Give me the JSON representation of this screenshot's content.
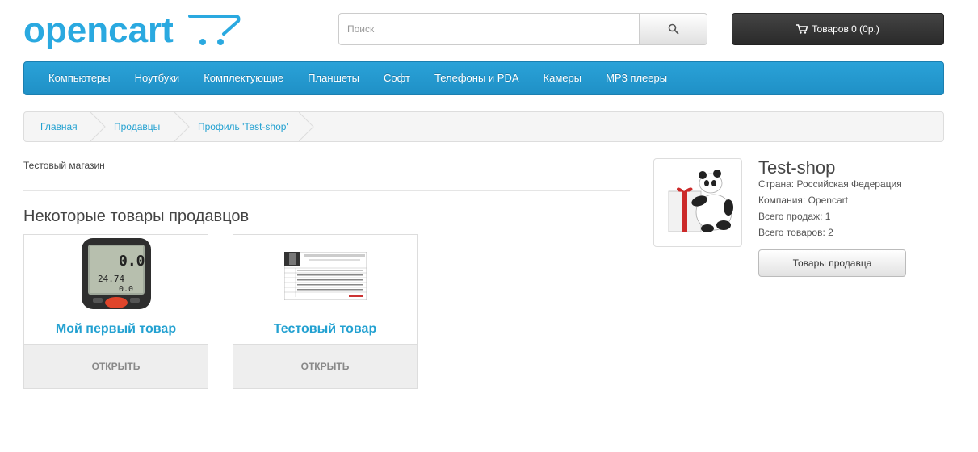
{
  "logo": {
    "text": "opencart"
  },
  "search": {
    "placeholder": "Поиск",
    "icon": "search-icon"
  },
  "cart": {
    "label": "Товаров 0 (0р.)",
    "icon": "shopping-cart-icon"
  },
  "menu": {
    "items": [
      "Компьютеры",
      "Ноутбуки",
      "Комплектующие",
      "Планшеты",
      "Софт",
      "Телефоны и PDA",
      "Камеры",
      "MP3 плееры"
    ]
  },
  "breadcrumb": {
    "items": [
      "Главная",
      "Продавцы",
      "Профиль 'Test-shop'"
    ]
  },
  "content": {
    "description": "Тестовый магазин",
    "section_title": "Некоторые товары продавцов",
    "products": [
      {
        "name": "Мой первый товар",
        "button": "ОТКРЫТЬ",
        "image": "bike-computer-image"
      },
      {
        "name": "Тестовый товар",
        "button": "ОТКРЫТЬ",
        "image": "spreadsheet-image"
      }
    ]
  },
  "seller": {
    "name": "Test-shop",
    "country": "Страна: Российская Федерация",
    "company": "Компания: Opencart",
    "total_sales": "Всего продаж: 1",
    "total_products": "Всего товаров: 2",
    "button": "Товары продавца",
    "image": "panda-gift-image"
  },
  "colors": {
    "accent": "#23a1d1",
    "menu": "#229ac8",
    "cart": "#363636"
  }
}
